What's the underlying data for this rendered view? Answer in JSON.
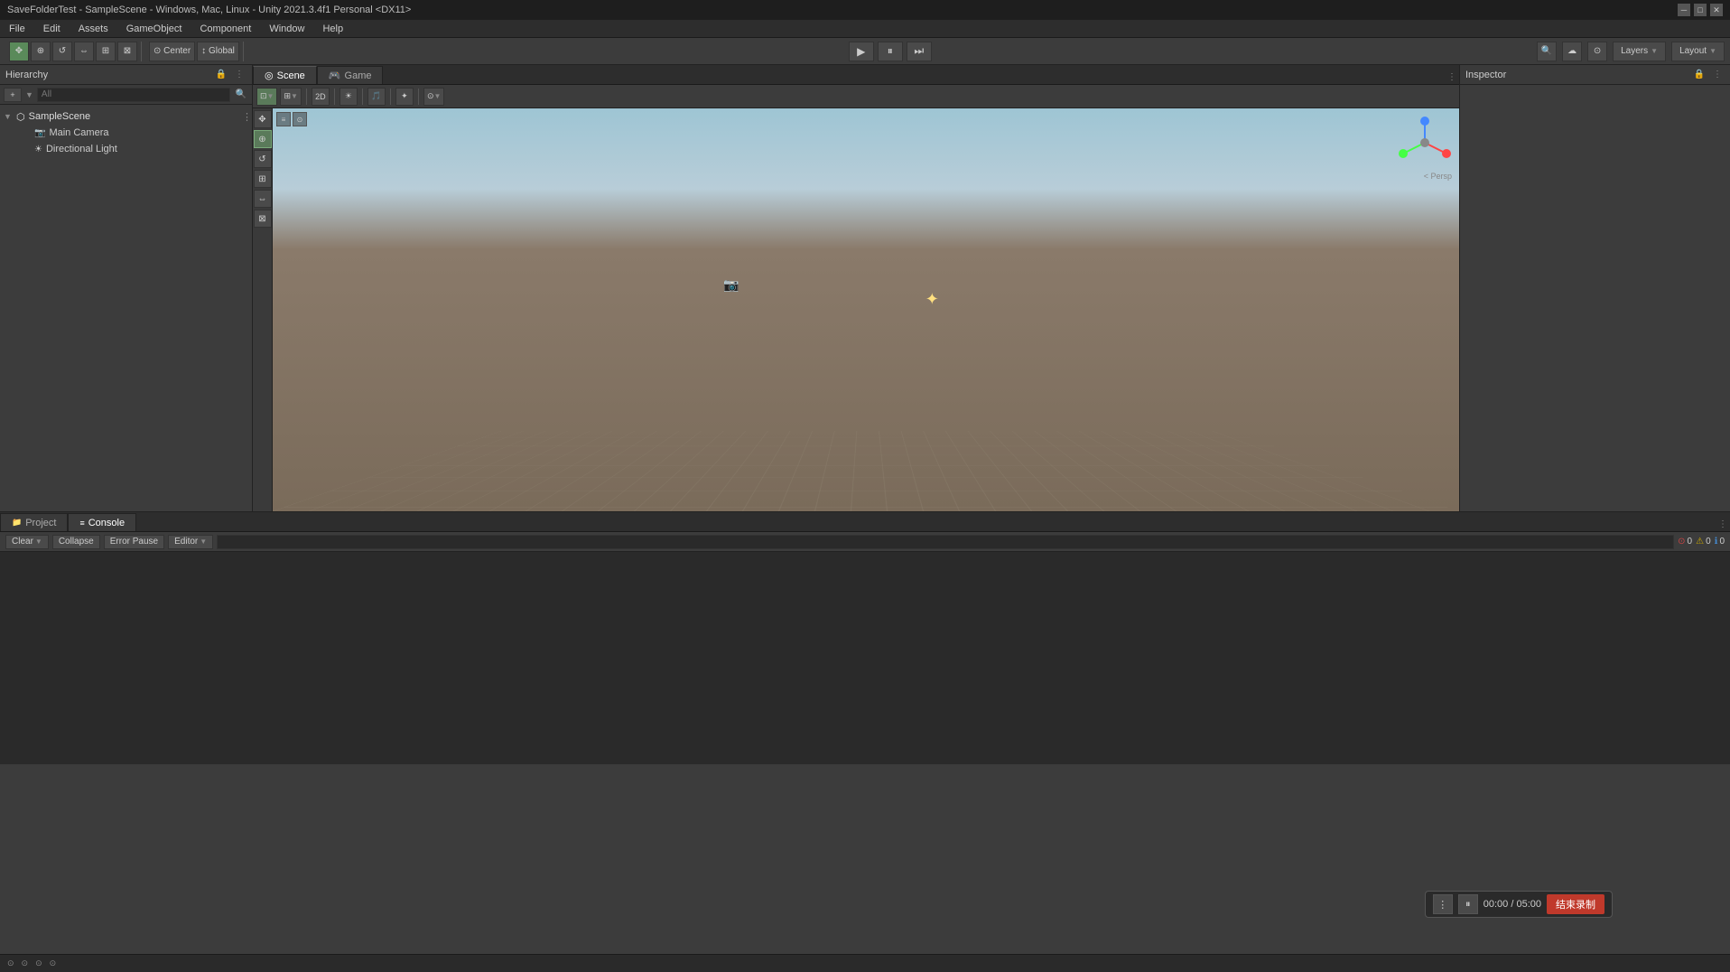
{
  "titlebar": {
    "title": "SaveFolderTest - SampleScene - Windows, Mac, Linux - Unity 2021.3.4f1 Personal <DX11>",
    "minimize": "─",
    "maximize": "□",
    "close": "✕"
  },
  "menubar": {
    "items": [
      "File",
      "Edit",
      "Assets",
      "GameObject",
      "Component",
      "Window",
      "Help"
    ]
  },
  "toolbar": {
    "transform_tools": [
      "⊕",
      "✥",
      "↺",
      "⊞",
      "⇔",
      "⊠"
    ],
    "play": "▶",
    "pause": "⏸",
    "step": "⏭",
    "layers_label": "Layers",
    "layout_label": "Layout",
    "search_icon": "🔍",
    "cloud_icon": "☁"
  },
  "hierarchy": {
    "title": "Hierarchy",
    "search_placeholder": "All",
    "scene_name": "SampleScene",
    "objects": [
      {
        "name": "SampleScene",
        "type": "scene",
        "icon": "⬡",
        "expanded": true
      },
      {
        "name": "Main Camera",
        "type": "camera",
        "icon": "📷",
        "indent": 1
      },
      {
        "name": "Directional Light",
        "type": "light",
        "icon": "☀",
        "indent": 1
      }
    ]
  },
  "scene": {
    "tabs": [
      {
        "label": "Scene",
        "icon": "◎",
        "active": true
      },
      {
        "label": "Game",
        "icon": "🎮",
        "active": false
      }
    ],
    "toolbar": {
      "shading_modes": [
        "⊡",
        "⊞"
      ],
      "view_modes": [
        "2D"
      ],
      "lighting_btn": "☀",
      "audio_btn": "♪",
      "fx_btn": "✦",
      "grid_btn": "⊞",
      "gizmos_btn": "⊙"
    },
    "persp_label": "< Persp"
  },
  "inspector": {
    "title": "Inspector"
  },
  "bottom": {
    "tabs": [
      {
        "label": "Project",
        "icon": "📁",
        "active": false
      },
      {
        "label": "Console",
        "icon": "≡",
        "active": true
      }
    ],
    "console": {
      "clear_btn": "Clear",
      "collapse_btn": "Collapse",
      "error_pause_btn": "Error Pause",
      "editor_btn": "Editor",
      "search_placeholder": "",
      "error_count": "0",
      "warning_count": "0",
      "info_count": "0"
    }
  },
  "record_widget": {
    "dots_icon": "⋮",
    "pause_icon": "⏸",
    "time": "00:00 / 05:00",
    "stop_label": "结束录制"
  },
  "statusbar": {
    "icons": [
      "⊙",
      "⊙",
      "⊙",
      "⊙"
    ]
  }
}
